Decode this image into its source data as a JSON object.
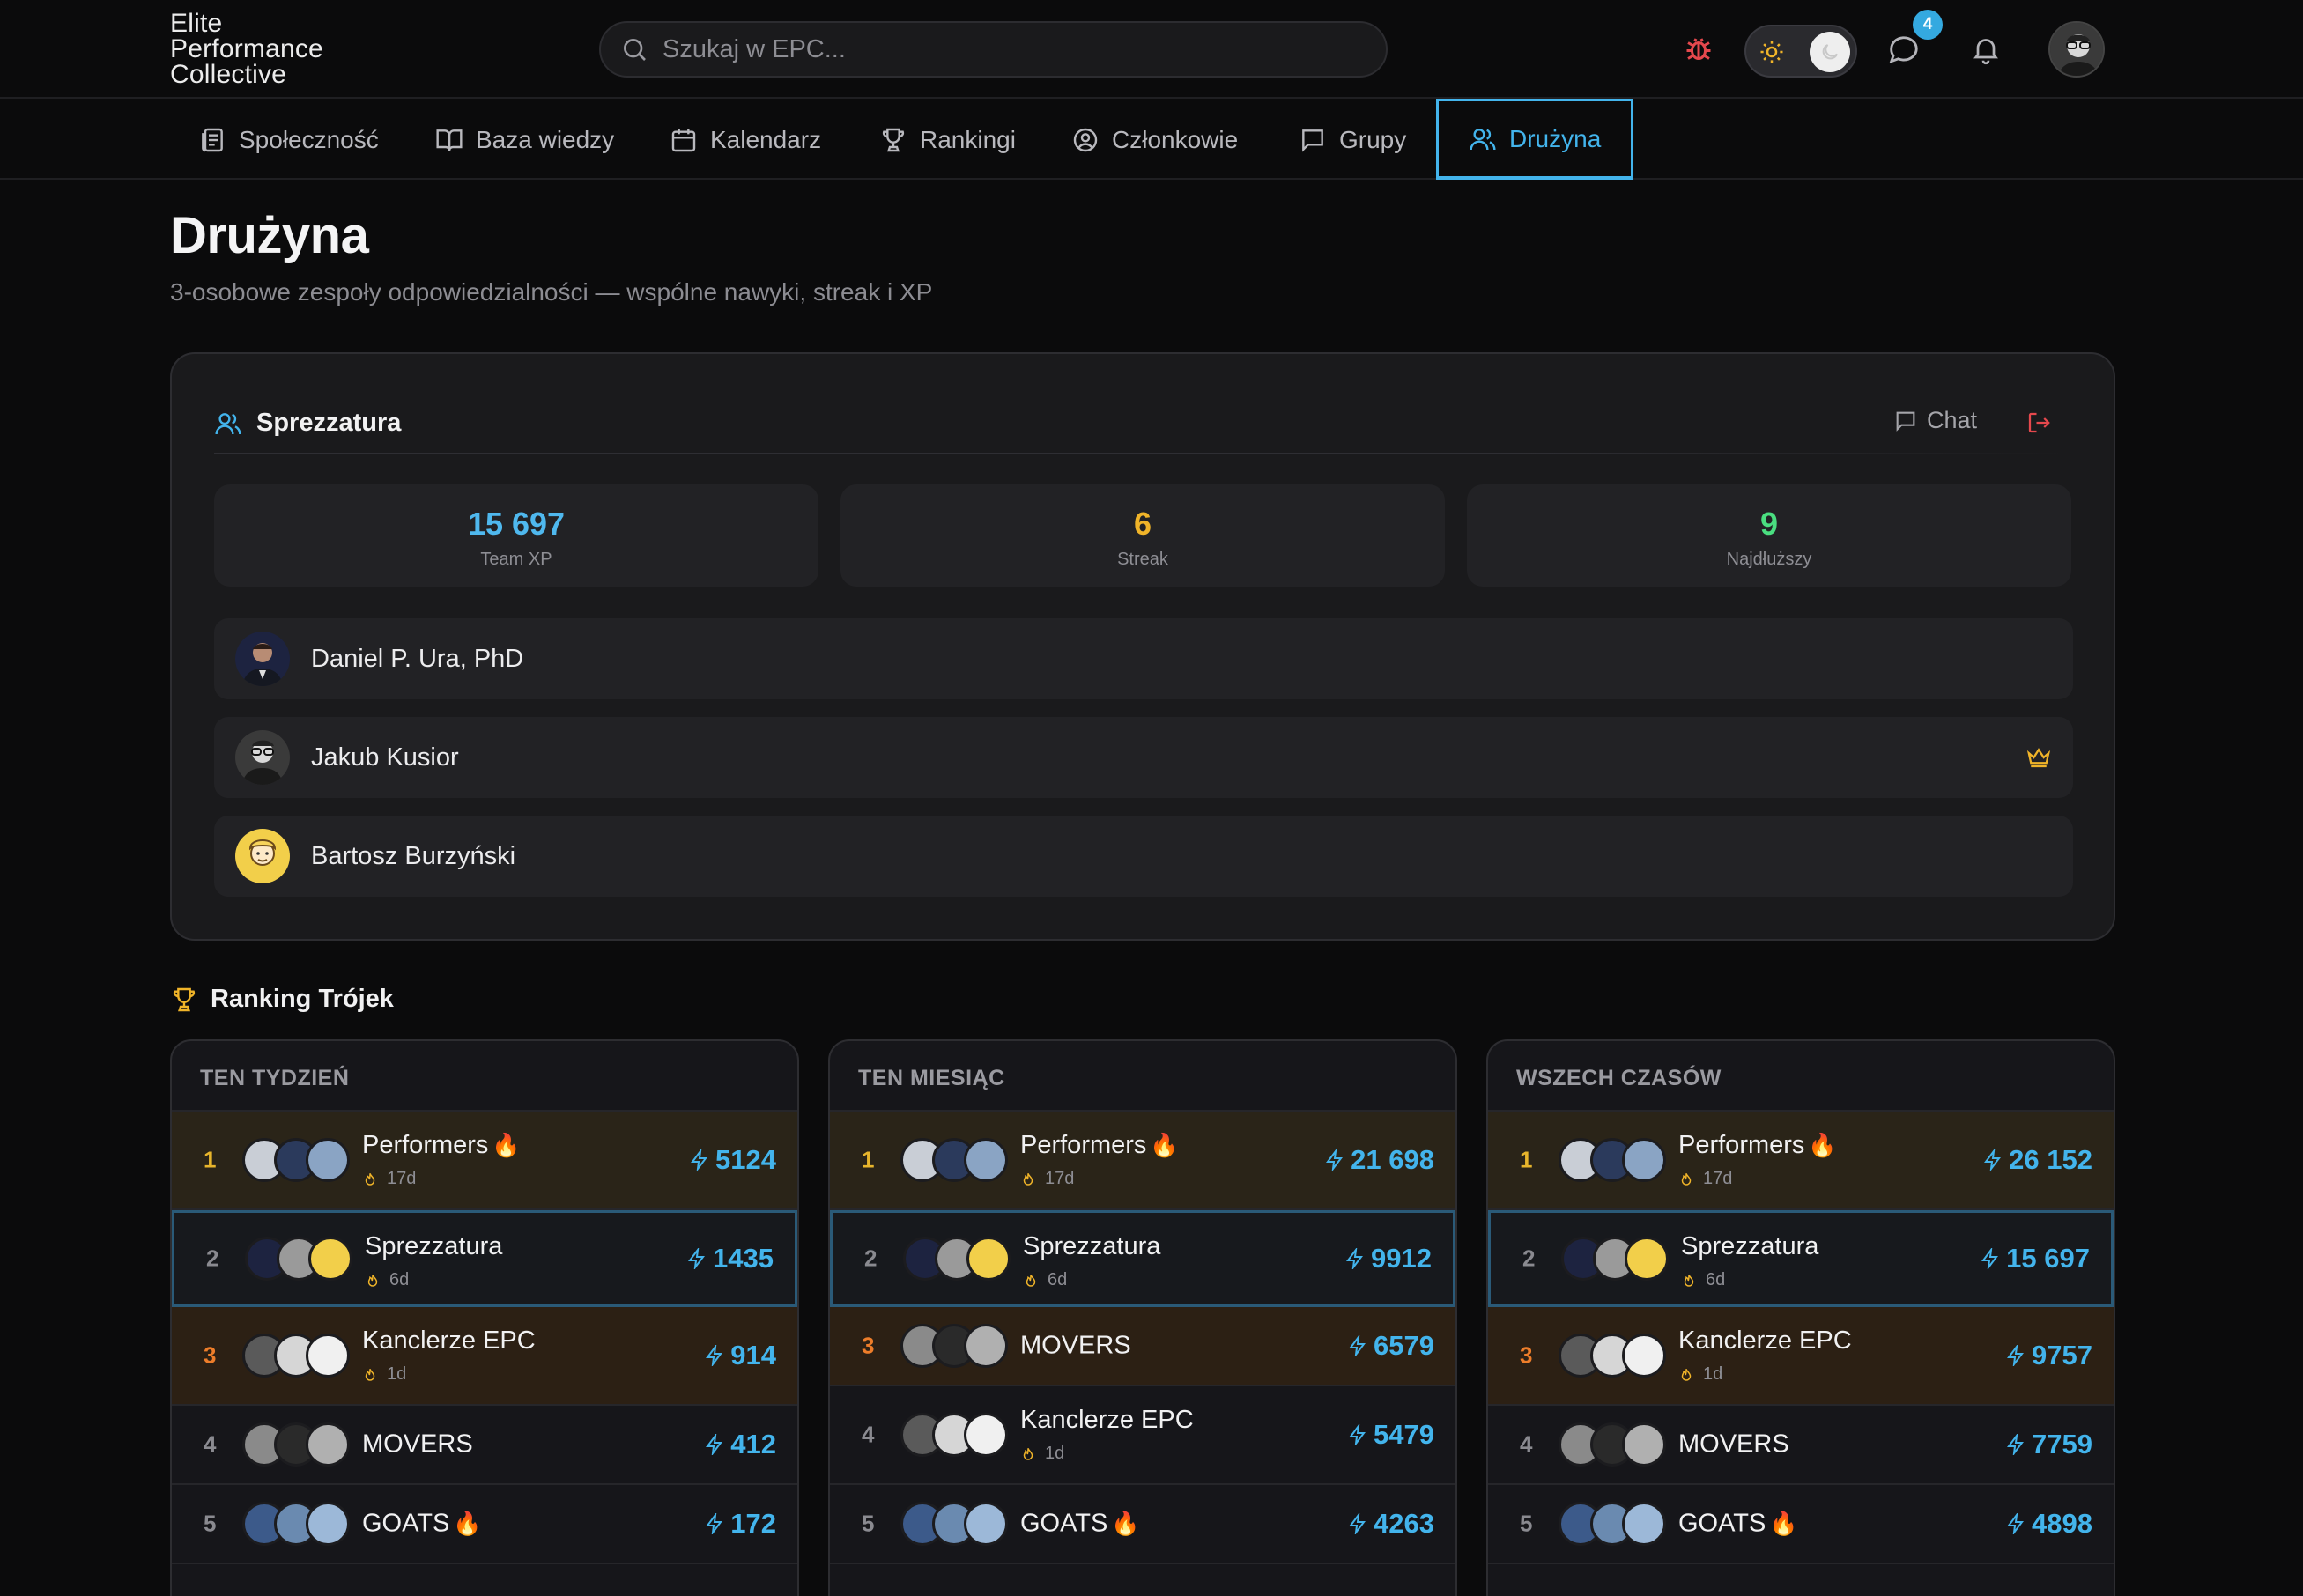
{
  "header": {
    "logo_lines": [
      "Elite",
      "Performance",
      "Collective"
    ],
    "search_placeholder": "Szukaj w EPC...",
    "message_badge": "4"
  },
  "nav": {
    "tabs": [
      {
        "label": "Społeczność",
        "icon": "feed-icon"
      },
      {
        "label": "Baza wiedzy",
        "icon": "book-icon"
      },
      {
        "label": "Kalendarz",
        "icon": "calendar-icon"
      },
      {
        "label": "Rankingi",
        "icon": "trophy-icon"
      },
      {
        "label": "Członkowie",
        "icon": "user-circle-icon"
      },
      {
        "label": "Grupy",
        "icon": "chat-square-icon"
      },
      {
        "label": "Drużyna",
        "icon": "users-icon",
        "active": true
      }
    ]
  },
  "page": {
    "title": "Drużyna",
    "subtitle": "3-osobowe zespoły odpowiedzialności — wspólne nawyki, streak i XP"
  },
  "team": {
    "name": "Sprezzatura",
    "chat_label": "Chat",
    "stats": [
      {
        "value": "15 697",
        "label": "Team XP",
        "color": "#4fb8ee"
      },
      {
        "value": "6",
        "label": "Streak",
        "color": "#f0b429"
      },
      {
        "value": "9",
        "label": "Najdłuższy",
        "color": "#4ade80"
      }
    ],
    "members": [
      {
        "name": "Daniel P. Ura, PhD",
        "leader": false
      },
      {
        "name": "Jakub Kusior",
        "leader": true
      },
      {
        "name": "Bartosz Burzyński",
        "leader": false
      }
    ]
  },
  "ranking": {
    "title": "Ranking Trójek",
    "boards": [
      {
        "title": "TEN TYDZIEŃ",
        "rows": [
          {
            "pos": "1",
            "name": "Performers",
            "fire": true,
            "streak": "17d",
            "xp": "5124"
          },
          {
            "pos": "2",
            "name": "Sprezzatura",
            "fire": false,
            "streak": "6d",
            "xp": "1435"
          },
          {
            "pos": "3",
            "name": "Kanclerze EPC",
            "fire": false,
            "streak": "1d",
            "xp": "914"
          },
          {
            "pos": "4",
            "name": "MOVERS",
            "fire": false,
            "streak": "",
            "xp": "412"
          },
          {
            "pos": "5",
            "name": "GOATS",
            "fire": true,
            "streak": "",
            "xp": "172"
          }
        ]
      },
      {
        "title": "TEN MIESIĄC",
        "rows": [
          {
            "pos": "1",
            "name": "Performers",
            "fire": true,
            "streak": "17d",
            "xp": "21 698"
          },
          {
            "pos": "2",
            "name": "Sprezzatura",
            "fire": false,
            "streak": "6d",
            "xp": "9912"
          },
          {
            "pos": "3",
            "name": "MOVERS",
            "fire": false,
            "streak": "",
            "xp": "6579"
          },
          {
            "pos": "4",
            "name": "Kanclerze EPC",
            "fire": false,
            "streak": "1d",
            "xp": "5479"
          },
          {
            "pos": "5",
            "name": "GOATS",
            "fire": true,
            "streak": "",
            "xp": "4263"
          }
        ]
      },
      {
        "title": "WSZECH CZASÓW",
        "rows": [
          {
            "pos": "1",
            "name": "Performers",
            "fire": true,
            "streak": "17d",
            "xp": "26 152"
          },
          {
            "pos": "2",
            "name": "Sprezzatura",
            "fire": false,
            "streak": "6d",
            "xp": "15 697"
          },
          {
            "pos": "3",
            "name": "Kanclerze EPC",
            "fire": false,
            "streak": "1d",
            "xp": "9757"
          },
          {
            "pos": "4",
            "name": "MOVERS",
            "fire": false,
            "streak": "",
            "xp": "7759"
          },
          {
            "pos": "5",
            "name": "GOATS",
            "fire": true,
            "streak": "",
            "xp": "4898"
          }
        ]
      }
    ]
  },
  "colors": {
    "accent": "#43b4ec",
    "gold": "#e7b52c",
    "bronze": "#ed7d2a",
    "danger": "#e5484d"
  }
}
